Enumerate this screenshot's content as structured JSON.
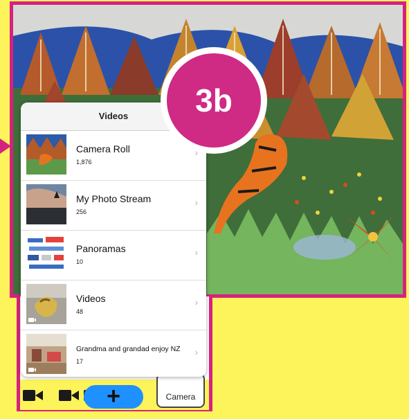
{
  "popover": {
    "title": "Videos",
    "albums": [
      {
        "title": "Camera Roll",
        "count": "1,876"
      },
      {
        "title": "My Photo Stream",
        "count": "256"
      },
      {
        "title": "Panoramas",
        "count": "10"
      },
      {
        "title": "Videos",
        "count": "48"
      },
      {
        "title": "Grandma and grandad enjoy NZ",
        "count": "17"
      }
    ],
    "chevron": "›"
  },
  "badge": {
    "label": "3b"
  },
  "toolbar": {
    "camera_label": "Camera",
    "add_label": "+",
    "icons": [
      "video-camera-icon",
      "video-camera-icon",
      "video-camera-icon"
    ]
  },
  "colors": {
    "background": "#fdf35a",
    "frame": "#d6227f",
    "badge": "#cf2a84",
    "add_button": "#1e90ff"
  }
}
